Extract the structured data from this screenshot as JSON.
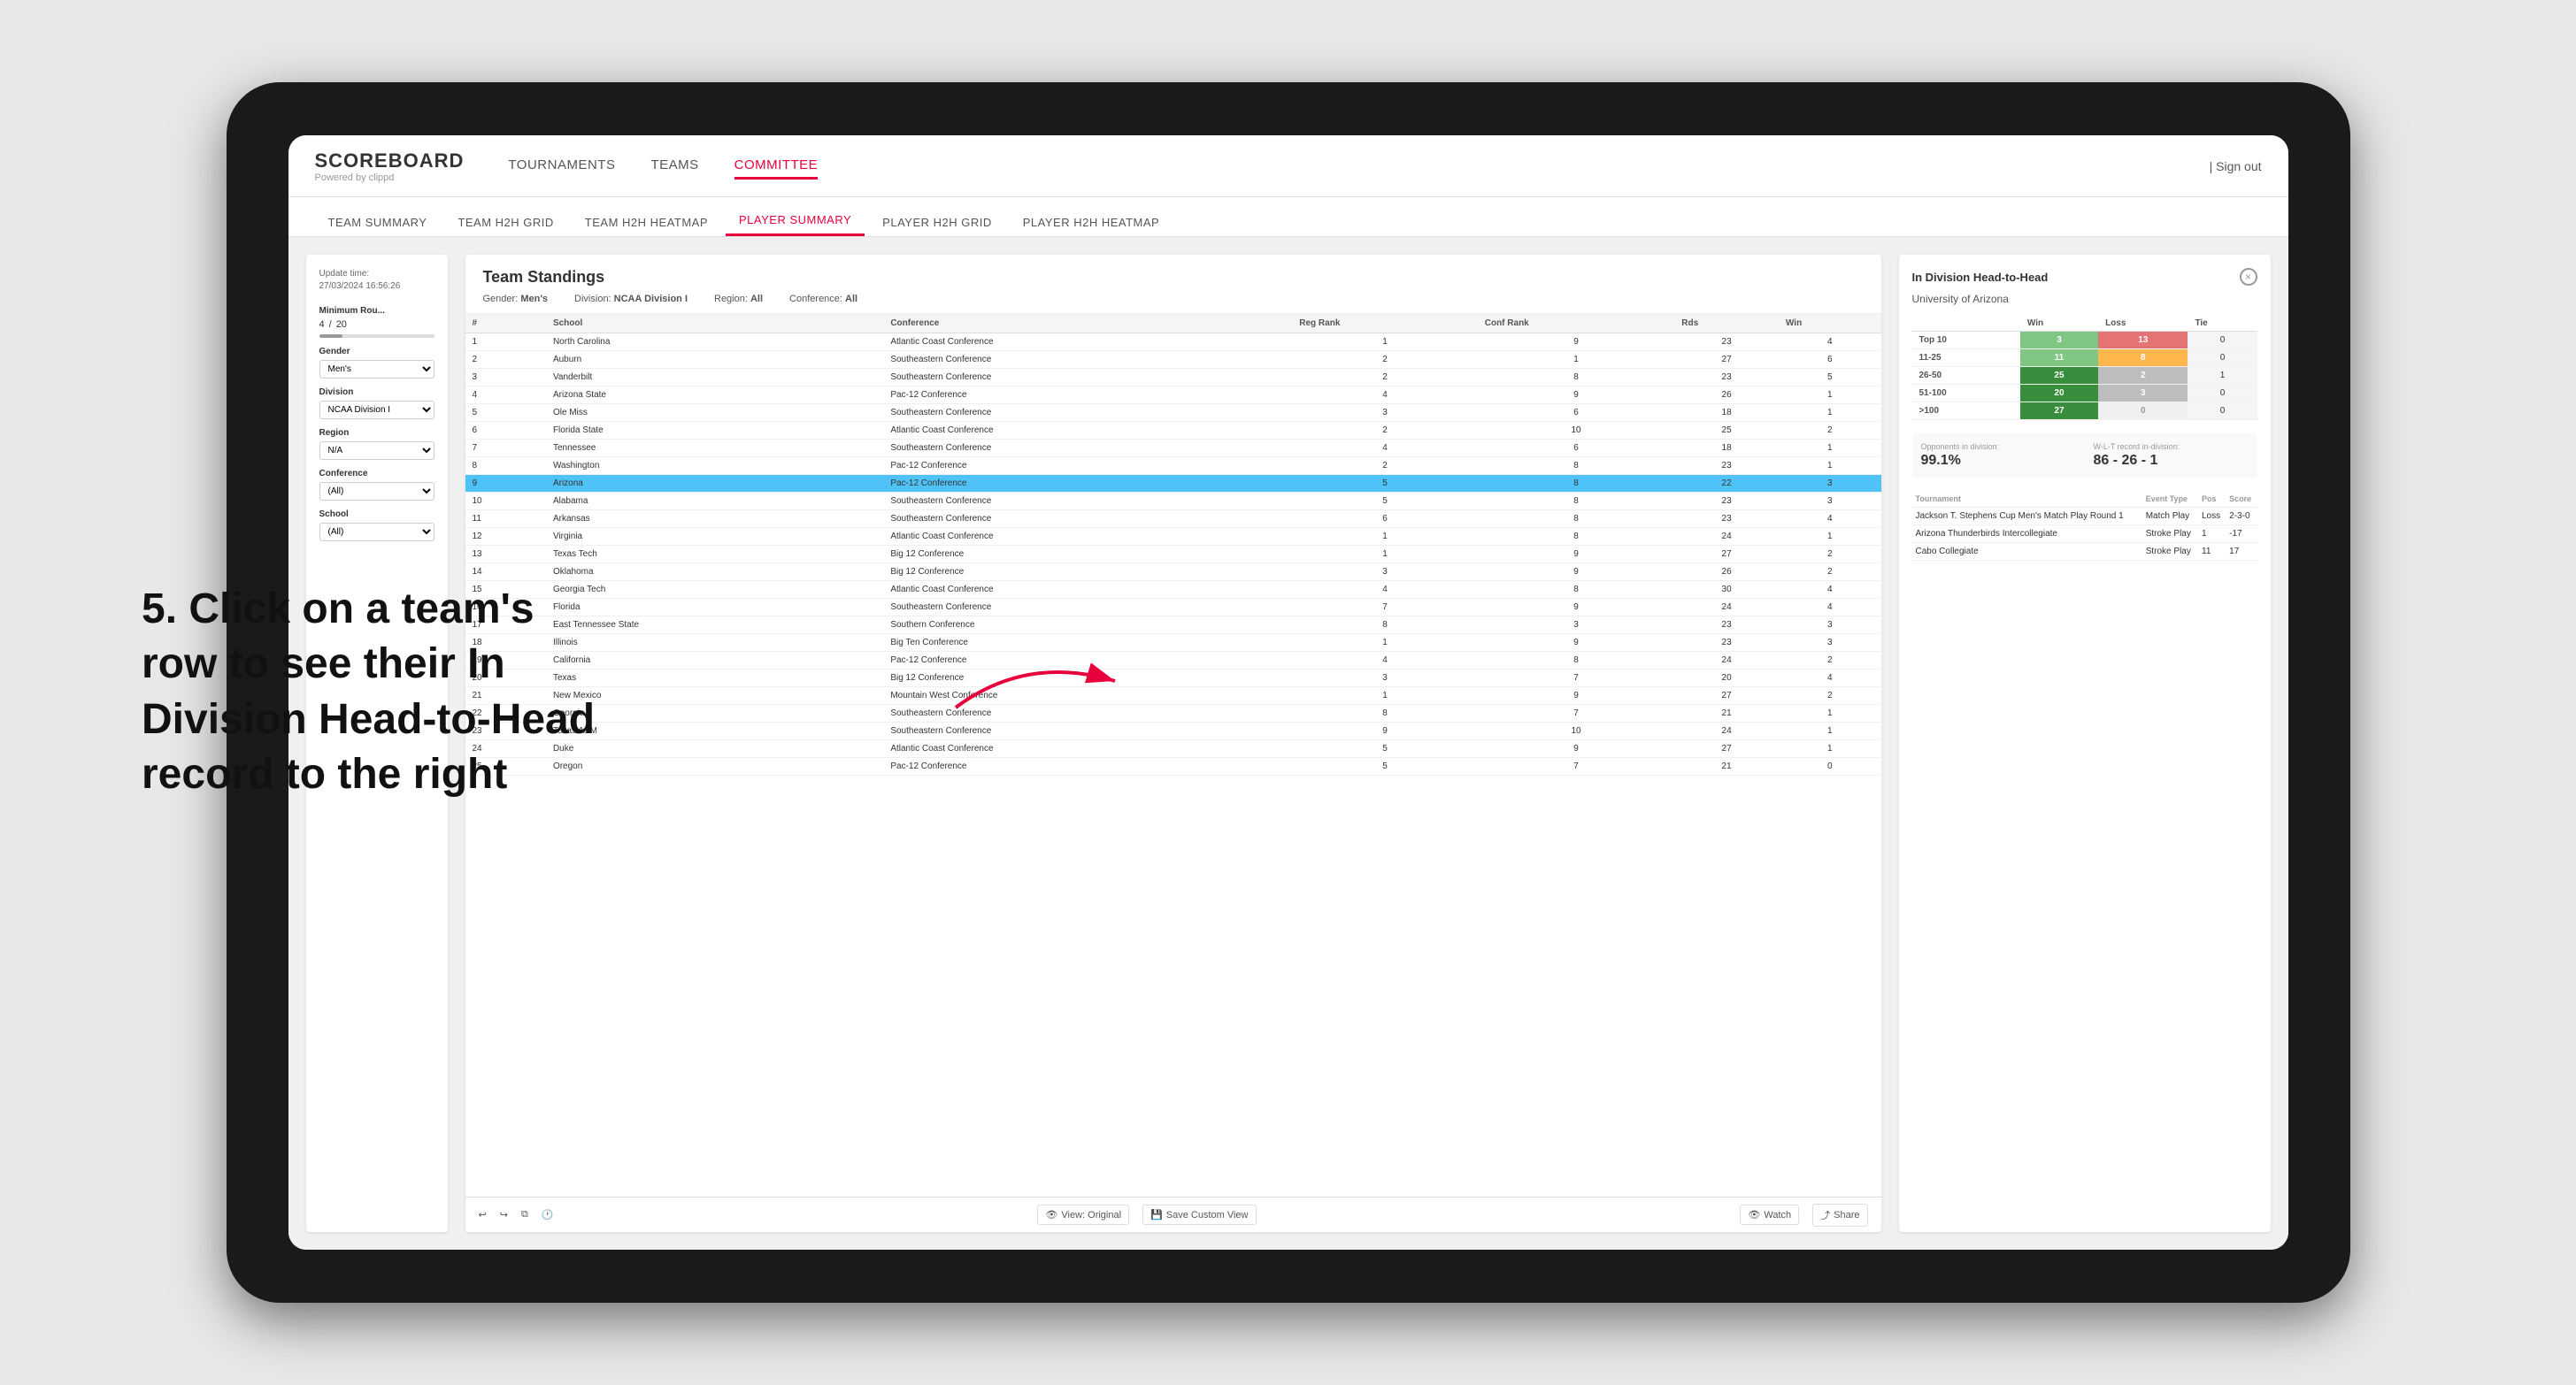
{
  "instruction": {
    "text": "5. Click on a team's row to see their In Division Head-to-Head record to the right"
  },
  "app": {
    "logo": {
      "title": "SCOREBOARD",
      "subtitle": "Powered by clippd"
    },
    "nav": {
      "items": [
        "TOURNAMENTS",
        "TEAMS",
        "COMMITTEE"
      ],
      "active": "COMMITTEE",
      "sign_out": "Sign out"
    },
    "sub_nav": {
      "items": [
        "TEAM SUMMARY",
        "TEAM H2H GRID",
        "TEAM H2H HEATMAP",
        "PLAYER SUMMARY",
        "PLAYER H2H GRID",
        "PLAYER H2H HEATMAP"
      ],
      "active": "PLAYER SUMMARY"
    },
    "filters": {
      "update_time_label": "Update time:",
      "update_time_value": "27/03/2024 16:56:26",
      "min_rounds_label": "Minimum Rou...",
      "min_rounds_value": "4",
      "min_rounds_max": "20",
      "gender_label": "Gender",
      "gender_value": "Men's",
      "division_label": "Division",
      "division_value": "NCAA Division I",
      "region_label": "Region",
      "region_value": "N/A",
      "conference_label": "Conference",
      "conference_value": "(All)",
      "school_label": "School",
      "school_value": "(All)"
    },
    "standings": {
      "title": "Team Standings",
      "gender": "Men's",
      "division": "NCAA Division I",
      "region": "All",
      "conference": "All",
      "columns": [
        "#",
        "School",
        "Conference",
        "Reg Rank",
        "Conf Rank",
        "Rds",
        "Win"
      ],
      "rows": [
        {
          "rank": 1,
          "school": "North Carolina",
          "conference": "Atlantic Coast Conference",
          "reg_rank": 1,
          "conf_rank": 9,
          "rds": 23,
          "win": 4
        },
        {
          "rank": 2,
          "school": "Auburn",
          "conference": "Southeastern Conference",
          "reg_rank": 2,
          "conf_rank": 1,
          "rds": 27,
          "win": 6
        },
        {
          "rank": 3,
          "school": "Vanderbilt",
          "conference": "Southeastern Conference",
          "reg_rank": 2,
          "conf_rank": 8,
          "rds": 23,
          "win": 5
        },
        {
          "rank": 4,
          "school": "Arizona State",
          "conference": "Pac-12 Conference",
          "reg_rank": 4,
          "conf_rank": 9,
          "rds": 26,
          "win": 1
        },
        {
          "rank": 5,
          "school": "Ole Miss",
          "conference": "Southeastern Conference",
          "reg_rank": 3,
          "conf_rank": 6,
          "rds": 18,
          "win": 1
        },
        {
          "rank": 6,
          "school": "Florida State",
          "conference": "Atlantic Coast Conference",
          "reg_rank": 2,
          "conf_rank": 10,
          "rds": 25,
          "win": 2
        },
        {
          "rank": 7,
          "school": "Tennessee",
          "conference": "Southeastern Conference",
          "reg_rank": 4,
          "conf_rank": 6,
          "rds": 18,
          "win": 1
        },
        {
          "rank": 8,
          "school": "Washington",
          "conference": "Pac-12 Conference",
          "reg_rank": 2,
          "conf_rank": 8,
          "rds": 23,
          "win": 1
        },
        {
          "rank": 9,
          "school": "Arizona",
          "conference": "Pac-12 Conference",
          "reg_rank": 5,
          "conf_rank": 8,
          "rds": 22,
          "win": 3,
          "selected": true
        },
        {
          "rank": 10,
          "school": "Alabama",
          "conference": "Southeastern Conference",
          "reg_rank": 5,
          "conf_rank": 8,
          "rds": 23,
          "win": 3
        },
        {
          "rank": 11,
          "school": "Arkansas",
          "conference": "Southeastern Conference",
          "reg_rank": 6,
          "conf_rank": 8,
          "rds": 23,
          "win": 4
        },
        {
          "rank": 12,
          "school": "Virginia",
          "conference": "Atlantic Coast Conference",
          "reg_rank": 1,
          "conf_rank": 8,
          "rds": 24,
          "win": 1
        },
        {
          "rank": 13,
          "school": "Texas Tech",
          "conference": "Big 12 Conference",
          "reg_rank": 1,
          "conf_rank": 9,
          "rds": 27,
          "win": 2
        },
        {
          "rank": 14,
          "school": "Oklahoma",
          "conference": "Big 12 Conference",
          "reg_rank": 3,
          "conf_rank": 9,
          "rds": 26,
          "win": 2
        },
        {
          "rank": 15,
          "school": "Georgia Tech",
          "conference": "Atlantic Coast Conference",
          "reg_rank": 4,
          "conf_rank": 8,
          "rds": 30,
          "win": 4
        },
        {
          "rank": 16,
          "school": "Florida",
          "conference": "Southeastern Conference",
          "reg_rank": 7,
          "conf_rank": 9,
          "rds": 24,
          "win": 4
        },
        {
          "rank": 17,
          "school": "East Tennessee State",
          "conference": "Southern Conference",
          "reg_rank": 8,
          "conf_rank": 3,
          "rds": 23,
          "win": 3
        },
        {
          "rank": 18,
          "school": "Illinois",
          "conference": "Big Ten Conference",
          "reg_rank": 1,
          "conf_rank": 9,
          "rds": 23,
          "win": 3
        },
        {
          "rank": 19,
          "school": "California",
          "conference": "Pac-12 Conference",
          "reg_rank": 4,
          "conf_rank": 8,
          "rds": 24,
          "win": 2
        },
        {
          "rank": 20,
          "school": "Texas",
          "conference": "Big 12 Conference",
          "reg_rank": 3,
          "conf_rank": 7,
          "rds": 20,
          "win": 4
        },
        {
          "rank": 21,
          "school": "New Mexico",
          "conference": "Mountain West Conference",
          "reg_rank": 1,
          "conf_rank": 9,
          "rds": 27,
          "win": 2
        },
        {
          "rank": 22,
          "school": "Georgia",
          "conference": "Southeastern Conference",
          "reg_rank": 8,
          "conf_rank": 7,
          "rds": 21,
          "win": 1
        },
        {
          "rank": 23,
          "school": "Texas A&M",
          "conference": "Southeastern Conference",
          "reg_rank": 9,
          "conf_rank": 10,
          "rds": 24,
          "win": 1
        },
        {
          "rank": 24,
          "school": "Duke",
          "conference": "Atlantic Coast Conference",
          "reg_rank": 5,
          "conf_rank": 9,
          "rds": 27,
          "win": 1
        },
        {
          "rank": 25,
          "school": "Oregon",
          "conference": "Pac-12 Conference",
          "reg_rank": 5,
          "conf_rank": 7,
          "rds": 21,
          "win": 0
        }
      ]
    },
    "h2h": {
      "title": "In Division Head-to-Head",
      "team": "University of Arizona",
      "close_btn": "×",
      "columns": [
        "",
        "Win",
        "Loss",
        "Tie"
      ],
      "rows": [
        {
          "range": "Top 10",
          "win": 3,
          "loss": 13,
          "tie": 0,
          "win_color": "green",
          "loss_color": "red"
        },
        {
          "range": "11-25",
          "win": 11,
          "loss": 8,
          "tie": 0,
          "win_color": "green",
          "loss_color": "yellow"
        },
        {
          "range": "26-50",
          "win": 25,
          "loss": 2,
          "tie": 1,
          "win_color": "dark-green",
          "loss_color": "gray"
        },
        {
          "range": "51-100",
          "win": 20,
          "loss": 3,
          "tie": 0,
          "win_color": "dark-green",
          "loss_color": "gray"
        },
        {
          "range": ">100",
          "win": 27,
          "loss": 0,
          "tie": 0,
          "win_color": "dark-green",
          "loss_color": "zero"
        }
      ],
      "opponents_label": "Opponents in division:",
      "opponents_value": "99.1%",
      "record_label": "W-L-T record in-division:",
      "record_value": "86 - 26 - 1",
      "tournaments": [
        {
          "name": "Jackson T. Stephens Cup Men's Match Play Round 1",
          "type": "Match Play",
          "pos": "Loss",
          "score": "2-3-0"
        },
        {
          "name": "Arizona Thunderbirds Intercollegiate",
          "type": "Stroke Play",
          "pos": 1,
          "score": "-17"
        },
        {
          "name": "Cabo Collegiate",
          "type": "Stroke Play",
          "pos": 11,
          "score": "17"
        }
      ]
    },
    "toolbar": {
      "view_original": "View: Original",
      "save_custom": "Save Custom View",
      "watch": "Watch",
      "share": "Share"
    }
  }
}
